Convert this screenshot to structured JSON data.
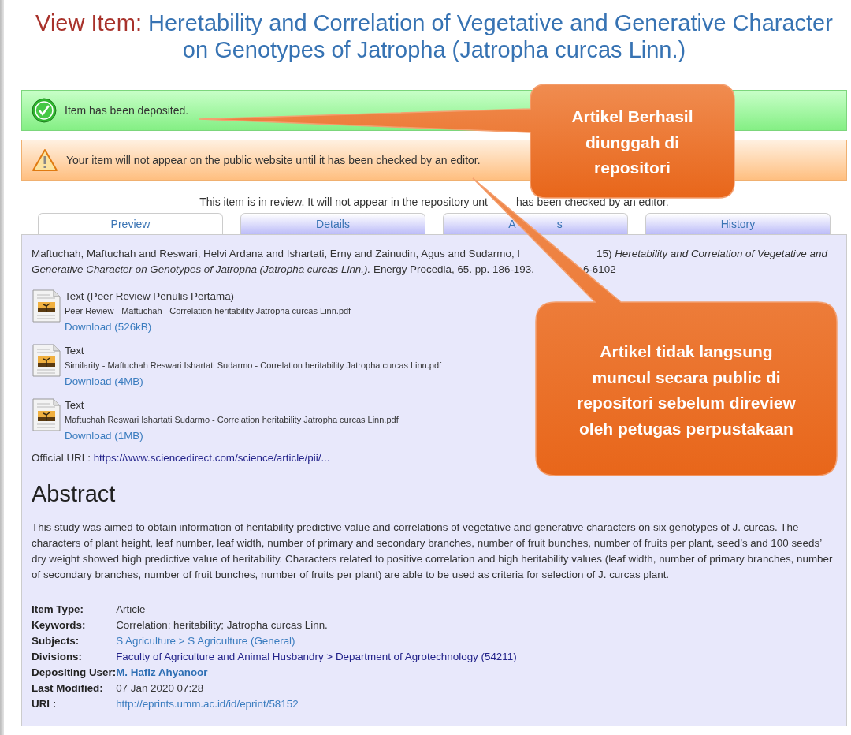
{
  "page_title": {
    "label": "View Item:",
    "title": "Heretability and Correlation of Vegetative and Generative Character on Genotypes of Jatropha (Jatropha curcas Linn.)"
  },
  "alerts": [
    {
      "kind": "success",
      "text": "Item has been deposited."
    },
    {
      "kind": "warning",
      "text": "Your item will not appear on the public website until it has been checked by an editor."
    }
  ],
  "review_notice": [
    "This item is in review. It will not appear in the repository unt",
    "has been checked by an editor."
  ],
  "tabs": [
    {
      "parts": [
        "Preview"
      ],
      "selected": true
    },
    {
      "parts": [
        "Details"
      ],
      "selected": false
    },
    {
      "parts": [
        "A",
        "s"
      ],
      "selected": false
    },
    {
      "parts": [
        "History"
      ],
      "selected": false
    }
  ],
  "citation": [
    [
      "Maftuchah, Maftuchah and Reswari, Helvi Ardana and Ishartati, Erny and Zainudin, Agus and Sudarmo, I",
      "15) *Heretability and Correlation of Vegetative and*"
    ],
    [
      "*Generative Character on Genotypes of Jatropha (Jatropha curcas Linn.).* Energy Procedia, 65. pp. 186-193.",
      "6-6102"
    ]
  ],
  "files": [
    {
      "type": "Text (Peer Review Penulis Pertama)",
      "filename": "Peer Review - Maftuchah - Correlation heritability Jatropha curcas Linn.pdf",
      "download": "Download (526kB)"
    },
    {
      "type": "Text",
      "filename": "Similarity - Maftuchah Reswari Ishartati Sudarmo - Correlation heritability Jatropha curcas Linn.pdf",
      "download": "Download (4MB)"
    },
    {
      "type": "Text",
      "filename": "Maftuchah Reswari Ishartati Sudarmo - Correlation heritability Jatropha curcas Linn.pdf",
      "download": "Download (1MB)"
    }
  ],
  "official_url": {
    "label": "Official URL:",
    "url": "https://www.sciencedirect.com/science/article/pii/..."
  },
  "abstract": {
    "heading": "Abstract",
    "text": "This study was aimed to obtain information of heritability predictive value and correlations of vegetative and generative characters on six genotypes of J. curcas. The characters of plant height, leaf number, leaf width, number of primary and secondary branches, number of fruit bunches, number of fruits per plant, seed’s and 100 seeds’ dry weight showed high predictive value of heritability. Characters related to positive correlation and high heritability values (leaf width, number of primary branches, number of secondary branches, number of fruit bunches, number of fruits per plant) are able to be used as criteria for selection of J. curcas plant."
  },
  "metadata": [
    {
      "key": "Item Type:",
      "value": "Article",
      "kind": "text"
    },
    {
      "key": "Keywords:",
      "value": "Correlation; heritability; Jatropha curcas Linn.",
      "kind": "text"
    },
    {
      "key": "Subjects:",
      "value": "S Agriculture > S Agriculture (General)",
      "kind": "link"
    },
    {
      "key": "Divisions:",
      "value": "Faculty of Agriculture and Animal Husbandry > Department of Agrotechnology (54211)",
      "kind": "darklink"
    },
    {
      "key": "Depositing User:",
      "value": "M. Hafiz Ahyanoor",
      "kind": "user"
    },
    {
      "key": "Last Modified:",
      "value": "07 Jan 2020 07:28",
      "kind": "text"
    },
    {
      "key": "URI :",
      "value": "http://eprints.umm.ac.id/id/eprint/58152",
      "kind": "link"
    }
  ],
  "callouts": [
    {
      "lines": [
        "Artikel Berhasil",
        "diunggah di",
        "repositori"
      ]
    },
    {
      "lines": [
        "Artikel tidak langsung",
        "muncul secara public di",
        "repositori sebelum direview",
        "oleh petugas perpustakaan"
      ]
    }
  ]
}
